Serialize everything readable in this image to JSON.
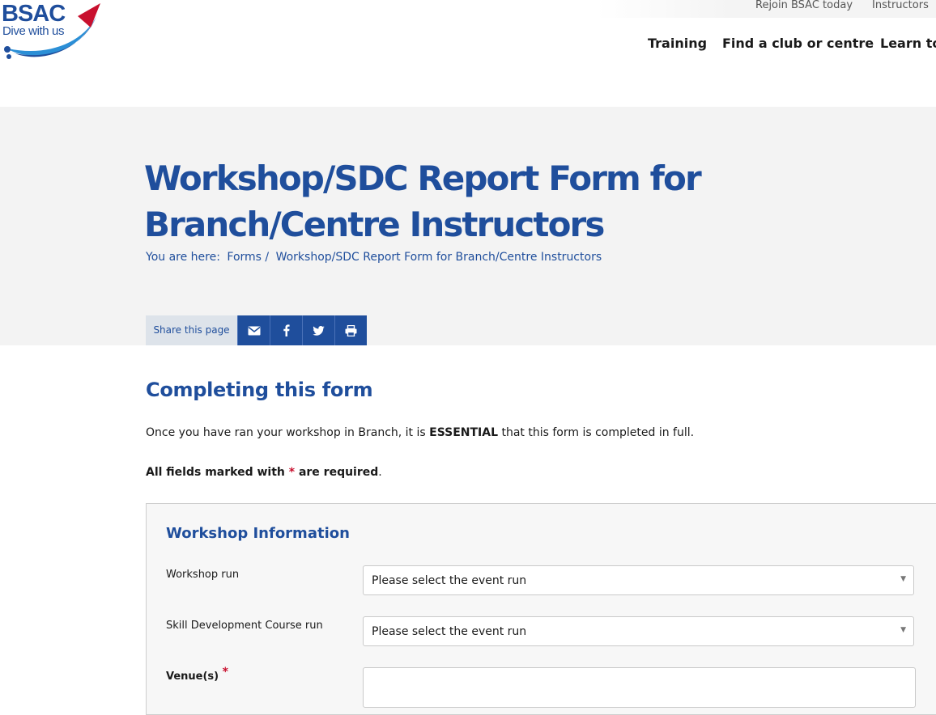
{
  "brand": {
    "name": "BSAC",
    "tagline": "Dive with us",
    "blue": "#1f4e9c",
    "red": "#c8102e"
  },
  "topbar": {
    "links": [
      "Rejoin BSAC today",
      "Instructors"
    ]
  },
  "nav": {
    "items": [
      "Training",
      "Find a club or centre",
      "Learn to"
    ]
  },
  "hero": {
    "title": "Workshop/SDC Report Form for Branch/Centre Instructors",
    "breadcrumb": {
      "prefix": "You are here:",
      "items": [
        "Forms",
        "/",
        "Workshop/SDC Report Form for Branch/Centre Instructors"
      ]
    },
    "share": {
      "label": "Share this page",
      "icons": [
        "email-icon",
        "facebook-icon",
        "twitter-icon",
        "print-icon"
      ]
    }
  },
  "content": {
    "heading": "Completing this form",
    "intro": {
      "before": "Once you have ran your workshop in Branch, it is ",
      "emphasis": "ESSENTIAL",
      "after": " that this form is completed in full."
    },
    "required": {
      "before": "All fields marked with ",
      "star": "*",
      "after": " are required",
      "end": "."
    }
  },
  "form": {
    "section_title": "Workshop Information",
    "fields": [
      {
        "label": "Workshop run",
        "value": "Please select the event run"
      },
      {
        "label": "Skill Development Course run",
        "value": "Please select the event run"
      },
      {
        "label": "Venue(s)",
        "required_mark": "*",
        "value": ""
      }
    ]
  }
}
